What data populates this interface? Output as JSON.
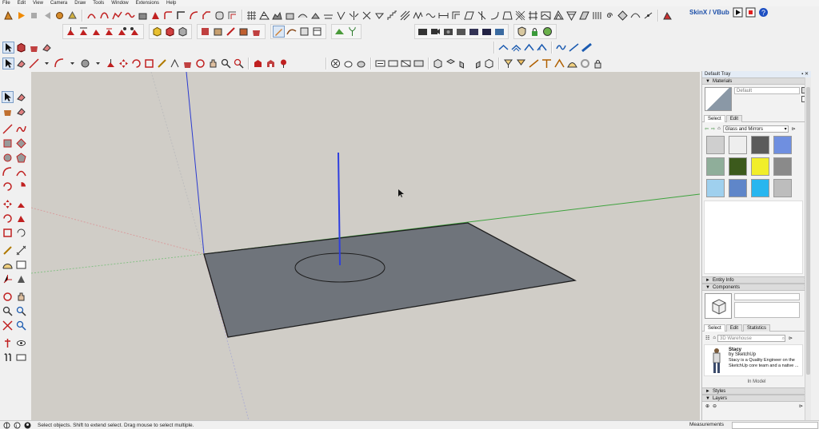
{
  "menu": [
    "File",
    "Edit",
    "View",
    "Camera",
    "Draw",
    "Tools",
    "Window",
    "Extensions",
    "Help"
  ],
  "skinx": {
    "label": "SkinX / VBub"
  },
  "tray": {
    "title": "Default Tray",
    "materials": {
      "header": "Materials",
      "name_value": "Default",
      "tabs": [
        "Select",
        "Edit"
      ],
      "library": "Glass and Mirrors",
      "swatches": [
        {
          "color": "#cfcfcf",
          "name": "clear-glass"
        },
        {
          "color": "#eeeeee",
          "name": "frosted-glass"
        },
        {
          "color": "#5b5b5b",
          "name": "mirror-tiles"
        },
        {
          "color": "#6f8fe0",
          "name": "blue-glass"
        },
        {
          "color": "#8fae9a",
          "name": "green-glass-pattern"
        },
        {
          "color": "#3c5a1c",
          "name": "dark-green-glass"
        },
        {
          "color": "#f1ee2a",
          "name": "yellow-glass"
        },
        {
          "color": "#8a8a8a",
          "name": "grey-glass"
        },
        {
          "color": "#9fd0ee",
          "name": "light-blue-textured"
        },
        {
          "color": "#5f86c9",
          "name": "blue-cloud-glass"
        },
        {
          "color": "#27b6ef",
          "name": "cyan-glass"
        },
        {
          "color": "#bdbdbd",
          "name": "speckled-glass"
        }
      ]
    },
    "entity_info": {
      "header": "Entity Info"
    },
    "components": {
      "header": "Components",
      "tabs": [
        "Select",
        "Edit",
        "Statistics"
      ],
      "search_placeholder": "3D Warehouse",
      "item_title": "Stacy",
      "item_author": "by SketchUp",
      "item_desc": "Stacy is a Quality Engineer on the SketchUp core team and a native ...",
      "in_model": "In Model"
    },
    "styles": {
      "header": "Styles"
    },
    "layers": {
      "header": "Layers"
    }
  },
  "status": {
    "text": "Select objects. Shift to extend select. Drag mouse to select multiple.",
    "measurements_label": "Measurements",
    "measurements_value": ""
  },
  "scene": {
    "plane_color": "#6f747b",
    "sky_color": "#d0cdc7"
  }
}
